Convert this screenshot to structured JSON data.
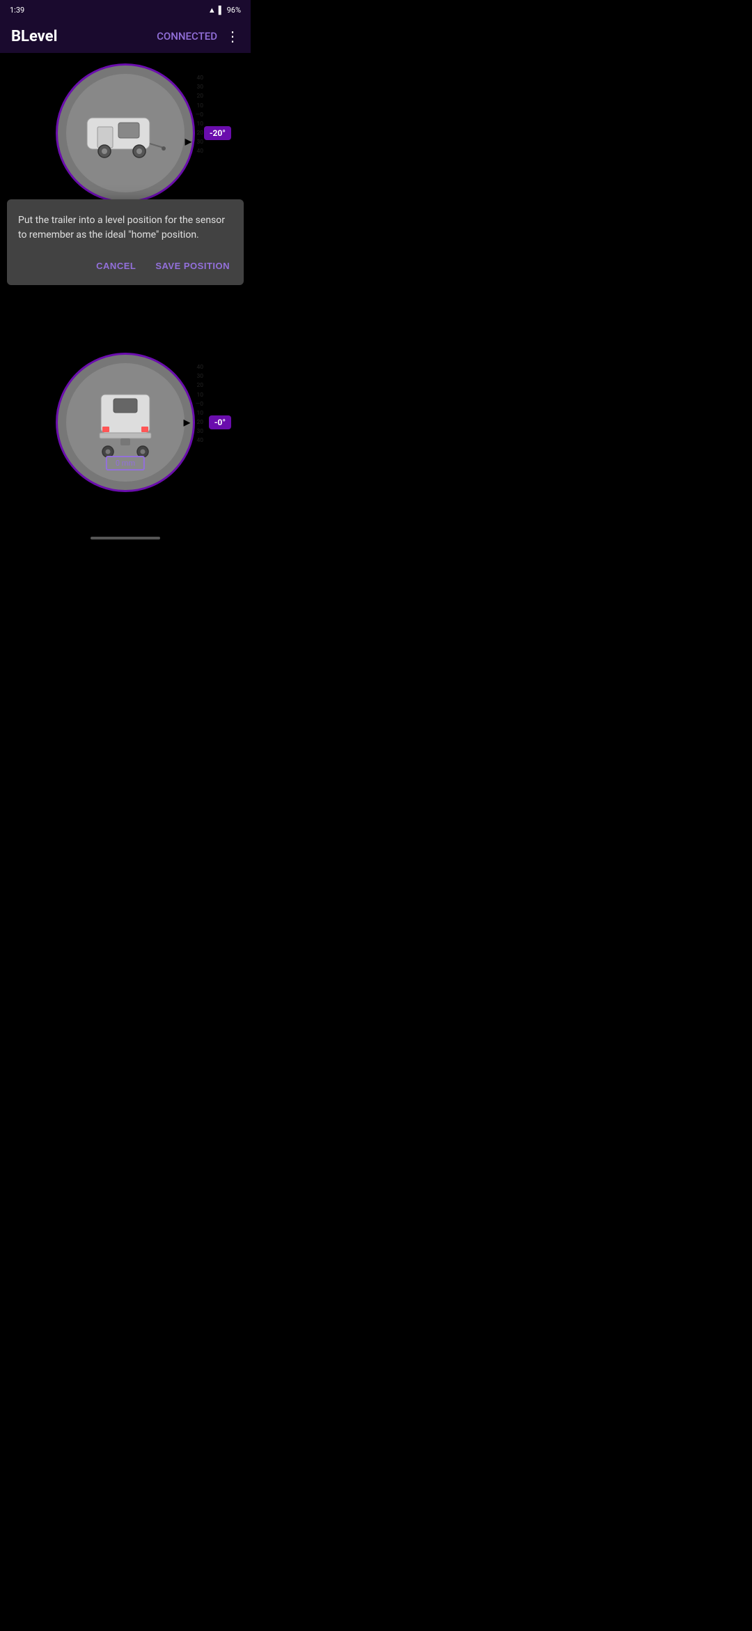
{
  "statusBar": {
    "time": "1:39",
    "battery": "96%"
  },
  "appBar": {
    "title": "BLevel",
    "connected": "CONNECTED",
    "menuIcon": "⋮"
  },
  "topGauge": {
    "angle": "-20°",
    "scaleValues": [
      "40",
      "30",
      "20",
      "10",
      "0",
      "10",
      "20",
      "30",
      "40"
    ]
  },
  "dialog": {
    "message": "Put the trailer into a level position for the sensor to remember as the ideal \"home\" position.",
    "cancelLabel": "CANCEL",
    "saveLabel": "SAVE POSITION"
  },
  "bottomGauge": {
    "angle": "-0°",
    "mmValue": "0 mm",
    "scaleValues": [
      "40",
      "30",
      "20",
      "10",
      "0",
      "10",
      "20",
      "30",
      "40"
    ]
  }
}
